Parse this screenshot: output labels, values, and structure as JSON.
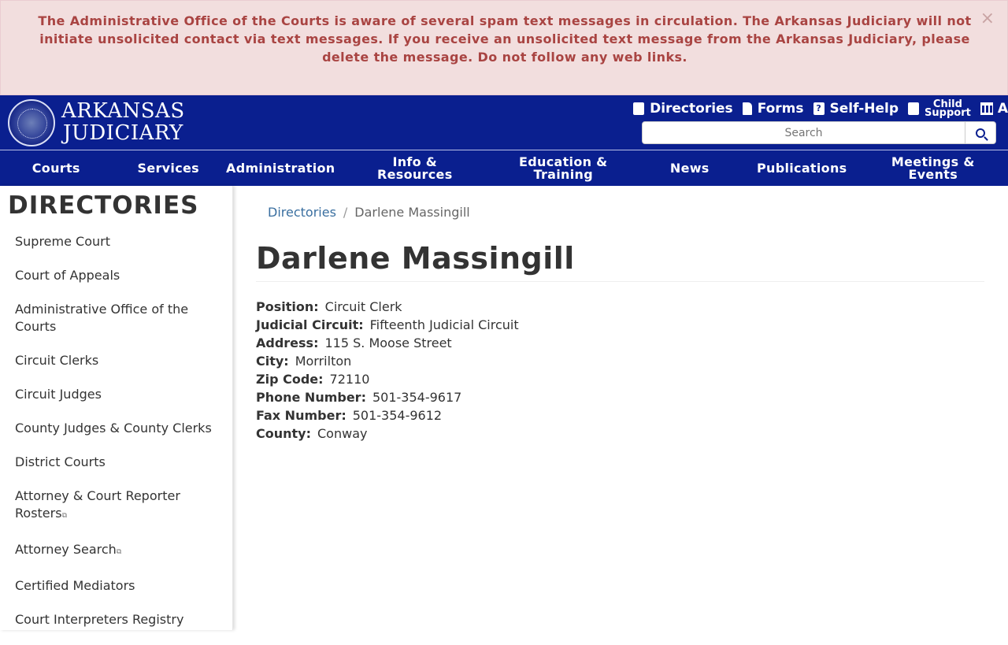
{
  "alert": {
    "message": "The Administrative Office of the Courts is aware of several spam text messages in circulation.  The Arkansas Judiciary will not initiate unsolicited contact via text messages. If you receive an unsolicited text message from the Arkansas Judiciary, please delete the message. Do not follow any web links.",
    "close": "×"
  },
  "header": {
    "logo_line1": "ARKANSAS",
    "logo_line2": "JUDICIARY",
    "utility_links": [
      "Directories",
      "Forms",
      "Self-Help",
      "Child",
      "Support",
      "A"
    ],
    "search_placeholder": "Search"
  },
  "nav": {
    "items": [
      "Courts",
      "Services",
      "Administration",
      "Info & Resources",
      "Education & Training",
      "News",
      "Publications",
      "Meetings & Events"
    ]
  },
  "sidebar": {
    "title": "DIRECTORIES",
    "items": [
      "Supreme Court",
      "Court of Appeals",
      "Administrative Office of the Courts",
      "Circuit Clerks",
      "Circuit Judges",
      "County Judges & County Clerks",
      "District Courts",
      "Attorney & Court Reporter Rosters",
      "Attorney Search",
      "Certified Mediators",
      "Court Interpreters Registry"
    ]
  },
  "breadcrumb": {
    "parent": "Directories",
    "separator": "/",
    "current": "Darlene Massingill"
  },
  "profile": {
    "name": "Darlene Massingill",
    "fields": [
      {
        "label": "Position:",
        "value": "Circuit Clerk"
      },
      {
        "label": "Judicial Circuit:",
        "value": "Fifteenth Judicial Circuit"
      },
      {
        "label": "Address:",
        "value": "115 S. Moose Street"
      },
      {
        "label": "City:",
        "value": "Morrilton"
      },
      {
        "label": "Zip Code:",
        "value": "72110"
      },
      {
        "label": "Phone Number:",
        "value": "501-354-9617"
      },
      {
        "label": "Fax Number:",
        "value": "501-354-9612"
      },
      {
        "label": "County:",
        "value": "Conway"
      }
    ]
  },
  "colors": {
    "brand_navy": "#0a1f8f",
    "alert_bg": "#f2dede",
    "alert_text": "#a94442",
    "link": "#3a6fa0"
  }
}
